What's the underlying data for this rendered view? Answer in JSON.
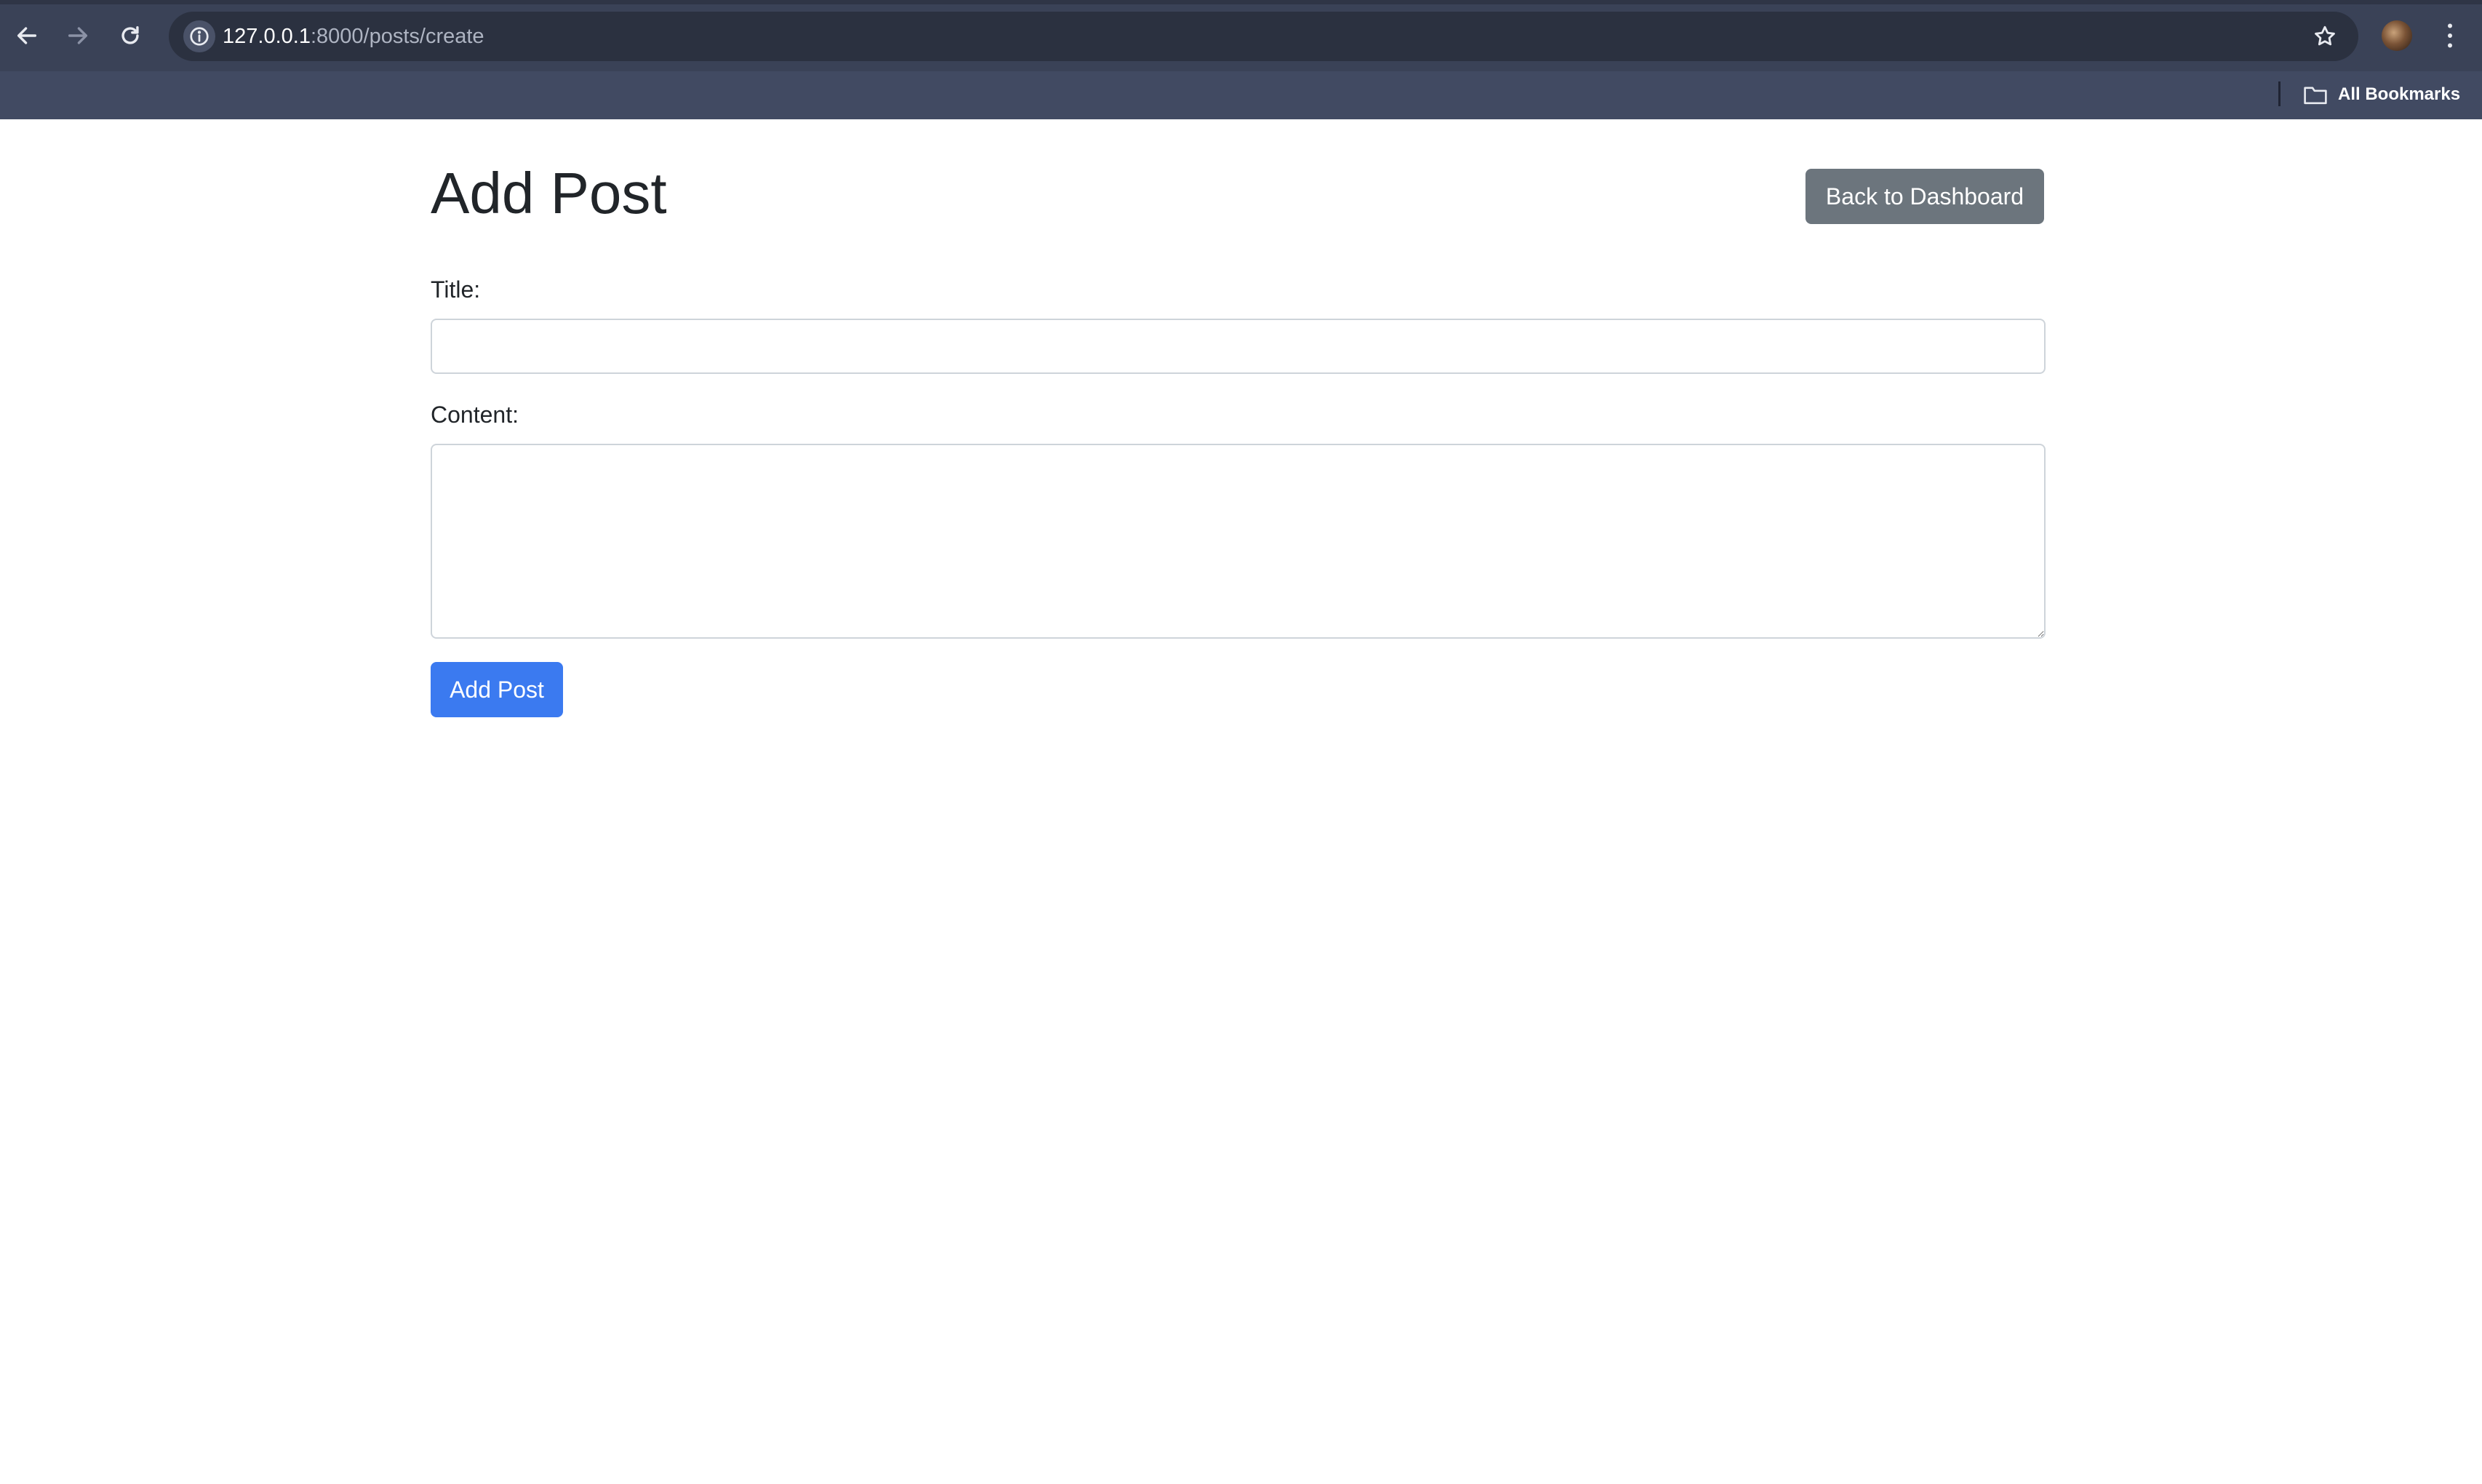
{
  "browser": {
    "url_host": "127.0.0.1",
    "url_path": ":8000/posts/create",
    "bookmarks_label": "All Bookmarks",
    "nav_icons": [
      "back-arrow-icon",
      "forward-arrow-icon",
      "reload-icon"
    ],
    "omnibox_icons": [
      "info-icon",
      "star-icon"
    ],
    "toolbar_color": "#3a4257",
    "bookmarks_bar_color": "#414a62"
  },
  "page": {
    "title": "Add Post",
    "back_button_label": "Back to Dashboard",
    "form": {
      "title_label": "Title:",
      "title_value": "",
      "content_label": "Content:",
      "content_value": "",
      "submit_label": "Add Post"
    },
    "colors": {
      "primary": "#3b7af0",
      "secondary": "#6c757d",
      "text": "#212529",
      "border": "#ced4da"
    }
  }
}
